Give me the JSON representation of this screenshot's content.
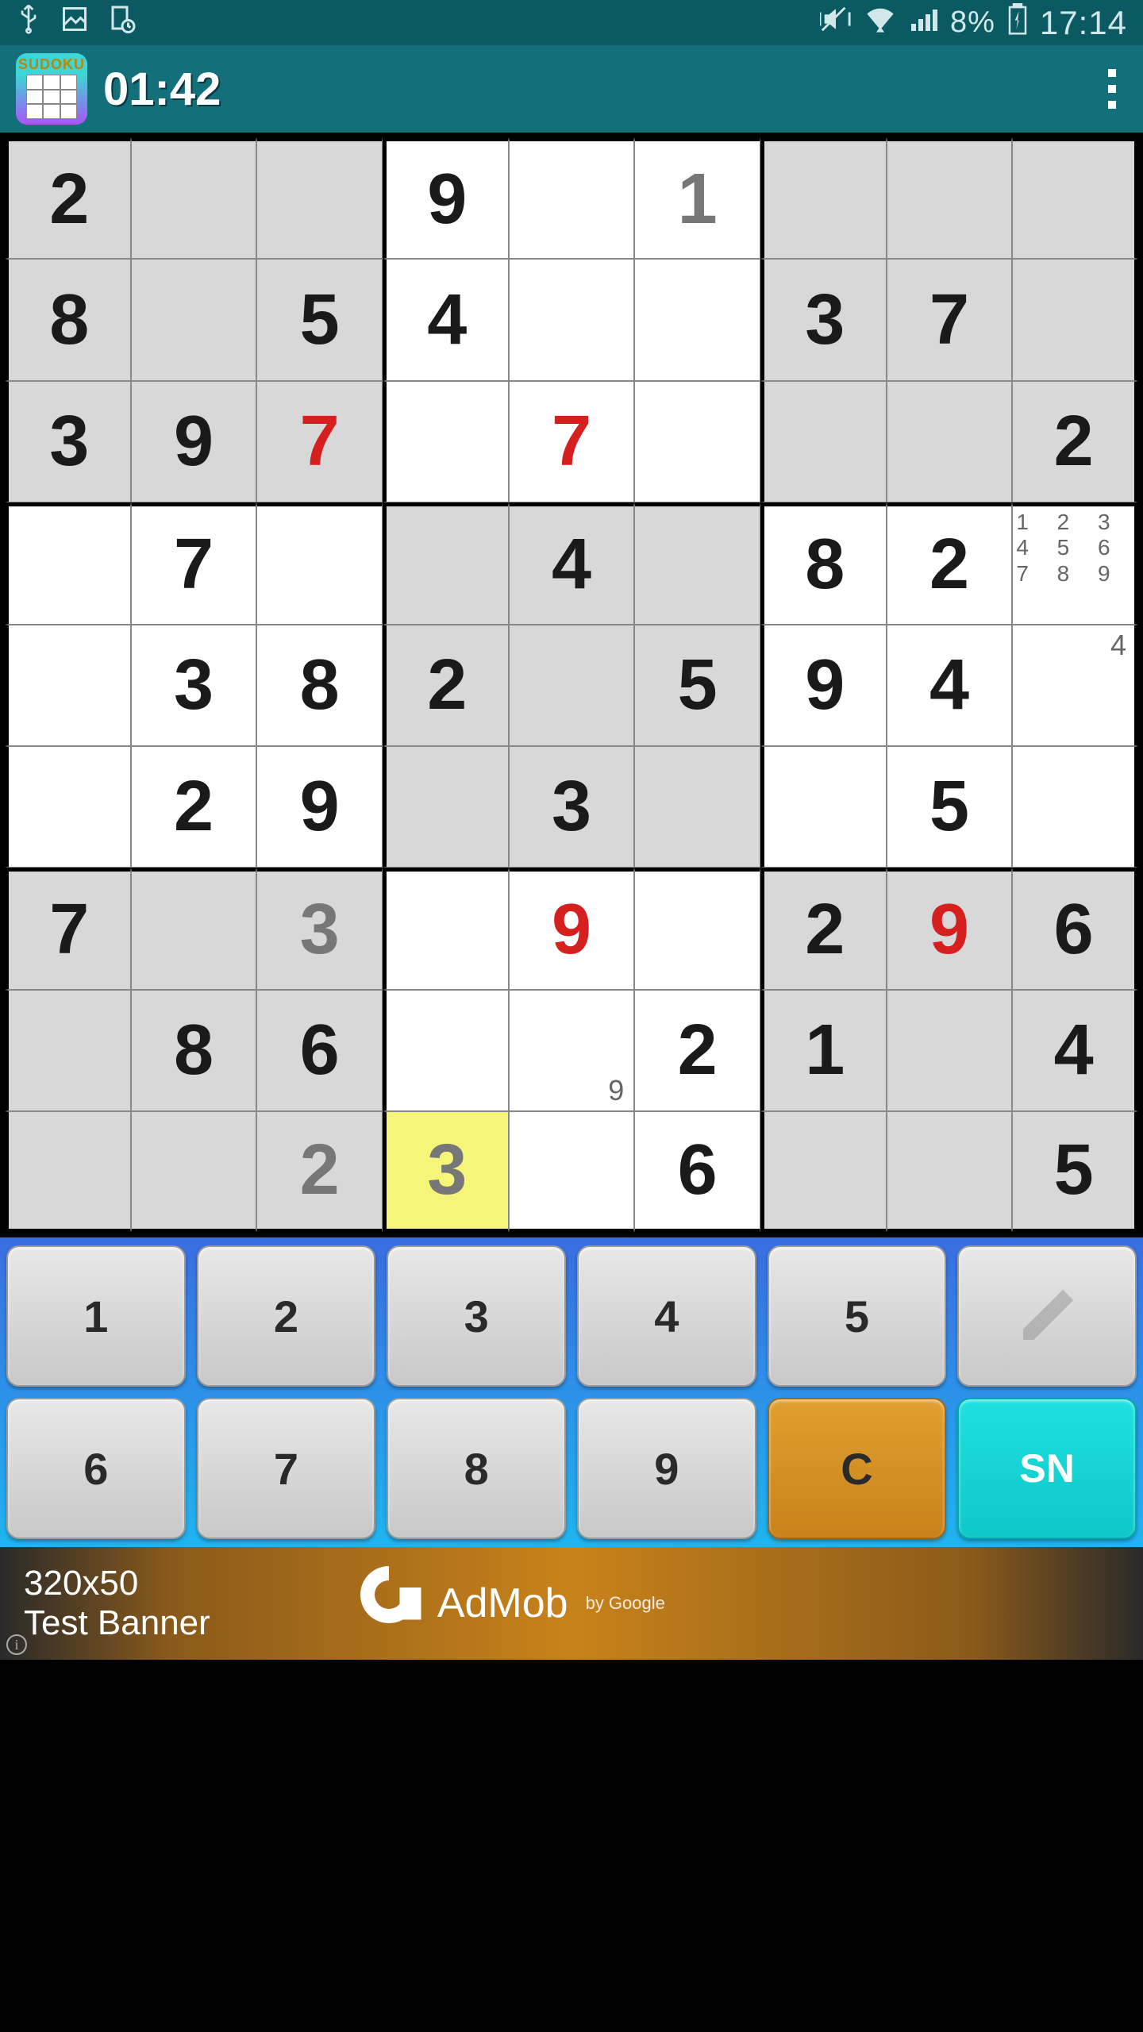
{
  "status": {
    "battery_text": "8%",
    "time": "17:14"
  },
  "app": {
    "icon_label": "SUDOKU",
    "timer": "01:42"
  },
  "board": {
    "shaded_boxes": [
      0,
      2,
      4,
      6,
      8
    ],
    "cells": [
      [
        {
          "v": "2"
        },
        {},
        {},
        {
          "v": "9"
        },
        {},
        {
          "v": "1",
          "c": "gray"
        },
        {},
        {},
        {}
      ],
      [
        {
          "v": "8"
        },
        {},
        {
          "v": "5"
        },
        {
          "v": "4"
        },
        {},
        {},
        {
          "v": "3"
        },
        {
          "v": "7"
        },
        {}
      ],
      [
        {
          "v": "3"
        },
        {
          "v": "9"
        },
        {
          "v": "7",
          "c": "red"
        },
        {},
        {
          "v": "7",
          "c": "red"
        },
        {},
        {},
        {},
        {
          "v": "2"
        }
      ],
      [
        {},
        {
          "v": "7"
        },
        {},
        {},
        {
          "v": "4"
        },
        {},
        {
          "v": "8"
        },
        {
          "v": "2"
        },
        {
          "pencil_full": "1 2 3\n4 5 6\n7 8 9"
        }
      ],
      [
        {},
        {
          "v": "3"
        },
        {
          "v": "8"
        },
        {
          "v": "2"
        },
        {},
        {
          "v": "5"
        },
        {
          "v": "9"
        },
        {
          "v": "4"
        },
        {
          "pencil_tr": "4"
        }
      ],
      [
        {},
        {
          "v": "2"
        },
        {
          "v": "9"
        },
        {},
        {
          "v": "3"
        },
        {},
        {},
        {
          "v": "5"
        },
        {}
      ],
      [
        {
          "v": "7"
        },
        {},
        {
          "v": "3",
          "c": "gray"
        },
        {},
        {
          "v": "9",
          "c": "red"
        },
        {},
        {
          "v": "2"
        },
        {
          "v": "9",
          "c": "red"
        },
        {
          "v": "6"
        }
      ],
      [
        {},
        {
          "v": "8"
        },
        {
          "v": "6"
        },
        {},
        {
          "pencil_br": "9"
        },
        {
          "v": "2"
        },
        {
          "v": "1"
        },
        {},
        {
          "v": "4"
        }
      ],
      [
        {},
        {},
        {
          "v": "2",
          "c": "gray"
        },
        {
          "v": "3",
          "c": "gray",
          "sel": true
        },
        {},
        {
          "v": "6"
        },
        {},
        {},
        {
          "v": "5"
        }
      ]
    ]
  },
  "numpad": {
    "keys_row1": [
      "1",
      "2",
      "3",
      "4",
      "5"
    ],
    "keys_row2": [
      "6",
      "7",
      "8",
      "9"
    ],
    "clear": "C",
    "sn": "SN"
  },
  "ad": {
    "line1": "320x50",
    "line2": "Test Banner",
    "brand": "AdMob",
    "by": "by Google"
  }
}
